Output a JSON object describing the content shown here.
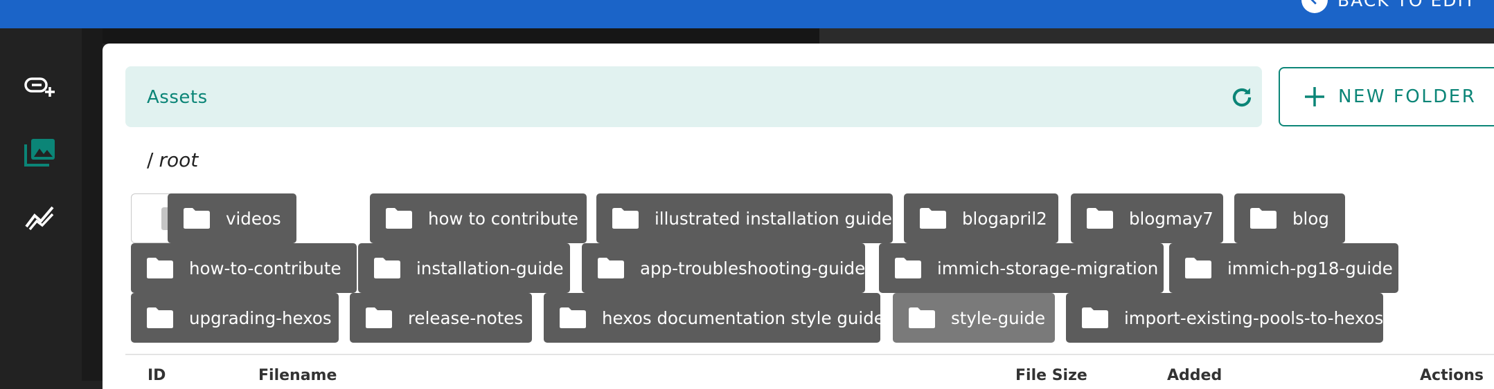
{
  "topbar": {
    "back_label": "BACK TO EDIT",
    "icons": {
      "back": "back-arrow-icon"
    }
  },
  "sidebar": {
    "items": [
      {
        "name": "add-link-icon"
      },
      {
        "name": "media-library-icon"
      },
      {
        "name": "analytics-icon"
      }
    ],
    "active_color": "#0b8577"
  },
  "assets_bar": {
    "title": "Assets",
    "refresh_icon": "refresh-icon"
  },
  "new_folder": {
    "label": "NEW FOLDER",
    "icon": "plus-icon"
  },
  "breadcrumb": {
    "separator": "/",
    "path": "root"
  },
  "upload": {
    "icon": "folder-upload-icon"
  },
  "folders": [
    "videos",
    "how to contribute",
    "illustrated installation guide",
    "blogapril2",
    "blogmay7",
    "blog",
    "how-to-contribute",
    "installation-guide",
    "app-troubleshooting-guide",
    "immich-storage-migration",
    "immich-pg18-guide",
    "upgrading-hexos",
    "release-notes",
    "hexos documentation style guide",
    "style-guide",
    "import-existing-pools-to-hexos"
  ],
  "table": {
    "headers": [
      "ID",
      "Filename",
      "File Size",
      "Added",
      "Actions"
    ]
  },
  "colors": {
    "topbar": "#1b64c8",
    "accent": "#0b8577",
    "assets_bar_bg": "#e1f2f0",
    "chip_bg": "#5c5c5c",
    "chip_hover_bg": "#7a7a7a"
  }
}
